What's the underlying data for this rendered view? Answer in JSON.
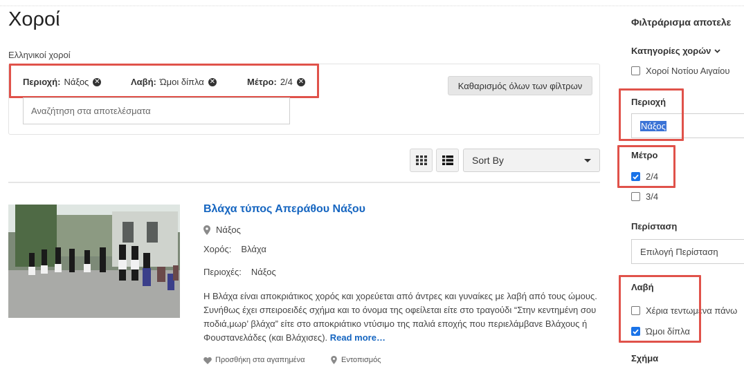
{
  "page": {
    "title": "Χοροί",
    "subtitle": "Ελληνικοί χοροί"
  },
  "filters": {
    "chips": [
      {
        "label": "Περιοχή:",
        "value": "Νάξος"
      },
      {
        "label": "Λαβή:",
        "value": "Ώμοι δίπλα"
      },
      {
        "label": "Μέτρο:",
        "value": "2/4"
      }
    ],
    "clear_all_label": "Καθαρισμός όλων των φίλτρων",
    "search_placeholder": "Αναζήτηση στα αποτελέσματα"
  },
  "toolbar": {
    "grid_view": "grid-view-icon",
    "list_view": "list-view-icon",
    "sort_label": "Sort By"
  },
  "result": {
    "title": "Βλάχα τύπος Απεράθου Νάξου",
    "location": "Νάξος",
    "dance_label": "Χορός:",
    "dance_value": "Βλάχα",
    "regions_label": "Περιοχές:",
    "regions_value": "Νάξος",
    "description": "Η Βλάχα είναι αποκριάτικος χορός και χορεύεται από άντρες και γυναίκες με λαβή από τους ώμους. Συνήθως έχει σπειροειδές σχήμα και το όνομα της οφείλεται είτε στο τραγούδι “Στην κεντημένη σου ποδιά,μωρ’ βλάχα” είτε στο αποκριάτικο ντύσιμο της παλιά εποχής που περιελάμβανε Βλάχους ή Φουστανελάδες (και Βλάχισες).",
    "read_more": "Read more…",
    "add_favorite": "Προσθήκη στα αγαπημένα",
    "locate": "Εντοπισμός"
  },
  "sidebar": {
    "title": "Φιλτράρισμα αποτελε",
    "categories_heading": "Κατηγορίες χορών",
    "categories": [
      {
        "label": "Χοροί Νοτίου Αιγαίου",
        "checked": false
      }
    ],
    "region_heading": "Περιοχή",
    "region_value": "Νάξος",
    "meter_heading": "Μέτρο",
    "meter_options": [
      {
        "label": "2/4",
        "checked": true
      },
      {
        "label": "3/4",
        "checked": false
      }
    ],
    "occasion_heading": "Περίσταση",
    "occasion_placeholder": "Επιλογή Περίσταση",
    "hold_heading": "Λαβή",
    "hold_options": [
      {
        "label": "Χέρια τεντωμένα πάνω",
        "checked": false
      },
      {
        "label": "Ώμοι δίπλα",
        "checked": true
      }
    ],
    "shape_heading": "Σχήμα"
  },
  "colors": {
    "link": "#1565c0",
    "highlight_border": "#e0524a",
    "checkbox_checked": "#1a73e8"
  }
}
